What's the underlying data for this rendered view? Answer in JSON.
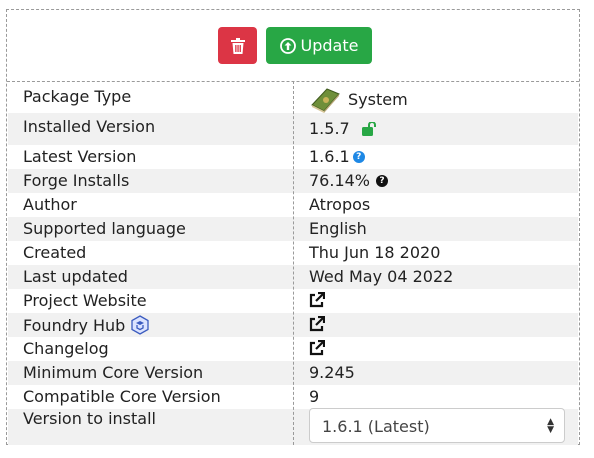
{
  "toolbar": {
    "update_label": "Update",
    "delete_icon": "trash-icon",
    "update_icon": "arrow-up-circle-icon"
  },
  "colors": {
    "delete": "#dc3545",
    "update": "#28a745",
    "info": "#1e88e5"
  },
  "rows": {
    "package_type": {
      "label": "Package Type",
      "value": "System"
    },
    "installed_version": {
      "label": "Installed Version",
      "value": "1.5.7"
    },
    "latest_version": {
      "label": "Latest Version",
      "value": "1.6.1"
    },
    "forge_installs": {
      "label": "Forge Installs",
      "value": "76.14%"
    },
    "author": {
      "label": "Author",
      "value": "Atropos"
    },
    "supported_language": {
      "label": "Supported language",
      "value": "English"
    },
    "created": {
      "label": "Created",
      "value": "Thu Jun 18 2020"
    },
    "last_updated": {
      "label": "Last updated",
      "value": "Wed May 04 2022"
    },
    "project_website": {
      "label": "Project Website"
    },
    "foundry_hub": {
      "label": "Foundry Hub"
    },
    "changelog": {
      "label": "Changelog"
    },
    "min_core": {
      "label": "Minimum Core Version",
      "value": "9.245"
    },
    "compat_core": {
      "label": "Compatible Core Version",
      "value": "9"
    },
    "version_to_install": {
      "label": "Version to install",
      "selected": "1.6.1 (Latest)"
    }
  }
}
